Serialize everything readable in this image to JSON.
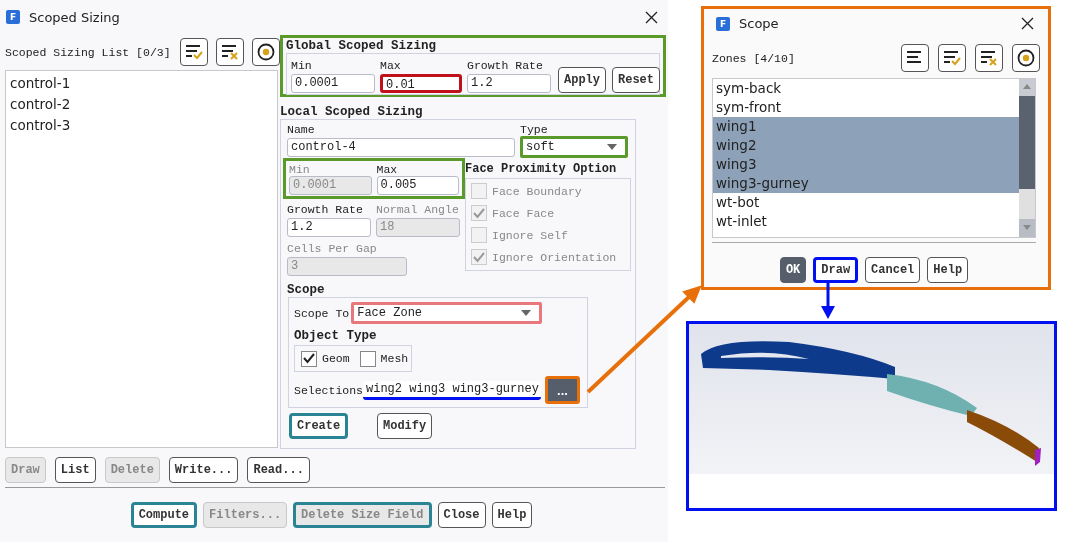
{
  "dialog": {
    "icon_letter": "F",
    "title": "Scoped Sizing"
  },
  "list_panel": {
    "label": "Scoped Sizing List [0/3]",
    "items": [
      {
        "label": "control-1",
        "selected": false
      },
      {
        "label": "control-2",
        "selected": false
      },
      {
        "label": "control-3",
        "selected": false
      }
    ]
  },
  "global": {
    "title": "Global Scoped Sizing",
    "color": "#5a9a2a",
    "fields": [
      {
        "label": "Min",
        "value": "0.0001"
      },
      {
        "label": "Max",
        "value": "0.01",
        "color": "#c0101a"
      },
      {
        "label": "Growth Rate",
        "value": "1.2"
      }
    ],
    "buttons": [
      "Apply",
      "Reset"
    ]
  },
  "local": {
    "title": "Local Scoped Sizing",
    "name": {
      "label": "Name",
      "value": "control-4"
    },
    "type": {
      "label": "Type",
      "value": "soft",
      "color": "#5a9a2a"
    },
    "size_group": {
      "color": "#5a9a2a"
    },
    "min": {
      "label": "Min",
      "value": "0.0001",
      "disabled": true
    },
    "max": {
      "label": "Max",
      "value": "0.005",
      "disabled": false
    },
    "growth_rate": {
      "label": "Growth Rate",
      "value": "1.2",
      "disabled": false
    },
    "normal_angle": {
      "label": "Normal Angle",
      "value": "18",
      "disabled": true
    },
    "cells_per_gap": {
      "label": "Cells Per Gap",
      "value": "3",
      "disabled": true
    },
    "proximity": {
      "title": "Face Proximity Option",
      "options": [
        {
          "label": "Face Boundary",
          "checked": false,
          "disabled": true
        },
        {
          "label": "Face Face",
          "checked": true,
          "disabled": true
        },
        {
          "label": "Ignore Self",
          "checked": false,
          "disabled": true
        },
        {
          "label": "Ignore Orientation",
          "checked": true,
          "disabled": true
        }
      ]
    },
    "scope": {
      "title": "Scope",
      "scope_to": {
        "label": "Scope To",
        "value": "Face Zone",
        "color": "#e8787c"
      },
      "object_type": {
        "title": "Object Type",
        "options": [
          {
            "label": "Geom",
            "checked": true
          },
          {
            "label": "Mesh",
            "checked": false
          }
        ]
      },
      "selections": {
        "label": "Selections",
        "value": "wing2 wing3 wing3-gurney",
        "color": "#0010f0"
      },
      "browse_button": {
        "label": "...",
        "color": "#e8700a"
      }
    },
    "buttons": [
      {
        "label": "Create",
        "color": "#2a8494"
      },
      {
        "label": "Modify"
      }
    ]
  },
  "list_buttons": [
    {
      "label": "Draw",
      "disabled": true
    },
    {
      "label": "List",
      "disabled": false
    },
    {
      "label": "Delete",
      "disabled": true
    },
    {
      "label": "Write...",
      "disabled": false
    },
    {
      "label": "Read...",
      "disabled": false
    }
  ],
  "footer_buttons": [
    {
      "label": "Compute",
      "disabled": false,
      "color": "#2a8494"
    },
    {
      "label": "Filters...",
      "disabled": true
    },
    {
      "label": "Delete Size Field",
      "disabled": true,
      "color": "#2a8494"
    },
    {
      "label": "Close",
      "disabled": false
    },
    {
      "label": "Help",
      "disabled": false
    }
  ],
  "scope_dialog": {
    "icon_letter": "F",
    "title": "Scope",
    "color": "#e8700a",
    "label": "Zones [4/10]",
    "zones": [
      {
        "label": "sym-back",
        "selected": false
      },
      {
        "label": "sym-front",
        "selected": false
      },
      {
        "label": "wing1",
        "selected": true
      },
      {
        "label": "wing2",
        "selected": true
      },
      {
        "label": "wing3",
        "selected": true
      },
      {
        "label": "wing3-gurney",
        "selected": true
      },
      {
        "label": "wt-bot",
        "selected": false
      },
      {
        "label": "wt-inlet",
        "selected": false
      }
    ],
    "buttons": [
      {
        "label": "OK",
        "kind": "default"
      },
      {
        "label": "Draw",
        "kind": "normal",
        "color": "#0010f0"
      },
      {
        "label": "Cancel",
        "kind": "normal"
      },
      {
        "label": "Help",
        "kind": "normal"
      }
    ]
  }
}
